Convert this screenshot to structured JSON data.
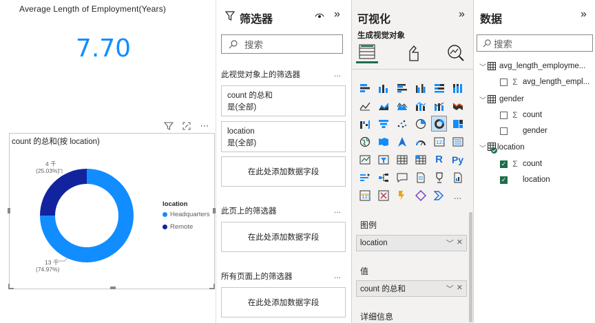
{
  "card": {
    "title": "Average Length of Employment(Years)",
    "value": "7.70"
  },
  "donut": {
    "title": "count 的总和(按 location)",
    "legend_title": "location",
    "legend": [
      {
        "label": "Headquarters",
        "color": "#118DFF"
      },
      {
        "label": "Remote",
        "color": "#12239E"
      }
    ],
    "labels": {
      "remote_value": "4 千",
      "remote_pct": "(25.03%)",
      "hq_value": "13 千",
      "hq_pct": "(74.97%)"
    }
  },
  "chart_data": {
    "type": "pie",
    "title": "count 的总和(按 location)",
    "categories": [
      "Headquarters",
      "Remote"
    ],
    "values": [
      74.97,
      25.03
    ],
    "data_labels": [
      "13 千 (74.97%)",
      "4 千 (25.03%)"
    ],
    "legend": "right",
    "donut": true
  },
  "filters": {
    "title": "筛选器",
    "search_placeholder": "搜索",
    "visual_section": "此视觉对象上的筛选器",
    "cards": [
      {
        "field": "count 的总和",
        "state": "是(全部)"
      },
      {
        "field": "location",
        "state": "是(全部)"
      }
    ],
    "add_field": "在此处添加数据字段",
    "page_section": "此页上的筛选器",
    "all_pages_section": "所有页面上的筛选器",
    "ellipsis": "..."
  },
  "viz": {
    "title": "可视化",
    "subtitle": "生成视觉对象",
    "r_label": "R",
    "py_label": "Py",
    "more": "...",
    "wells": {
      "legend_label": "图例",
      "legend_field": "location",
      "values_label": "值",
      "values_field": "count 的总和",
      "details_label": "详细信息"
    }
  },
  "data": {
    "title": "数据",
    "search_placeholder": "搜索",
    "tables": [
      {
        "name": "avg_length_employme...",
        "fields": [
          {
            "name": "avg_length_empl...",
            "sigma": true,
            "checked": false
          }
        ]
      },
      {
        "name": "gender",
        "fields": [
          {
            "name": "count",
            "sigma": true,
            "checked": false
          },
          {
            "name": "gender",
            "sigma": false,
            "checked": false
          }
        ]
      },
      {
        "name": "location",
        "fields": [
          {
            "name": "count",
            "sigma": true,
            "checked": true
          },
          {
            "name": "location",
            "sigma": false,
            "checked": true
          }
        ]
      }
    ]
  },
  "colors": {
    "accent": "#118DFF",
    "dark_series": "#12239E",
    "check": "#1E6C4B"
  }
}
